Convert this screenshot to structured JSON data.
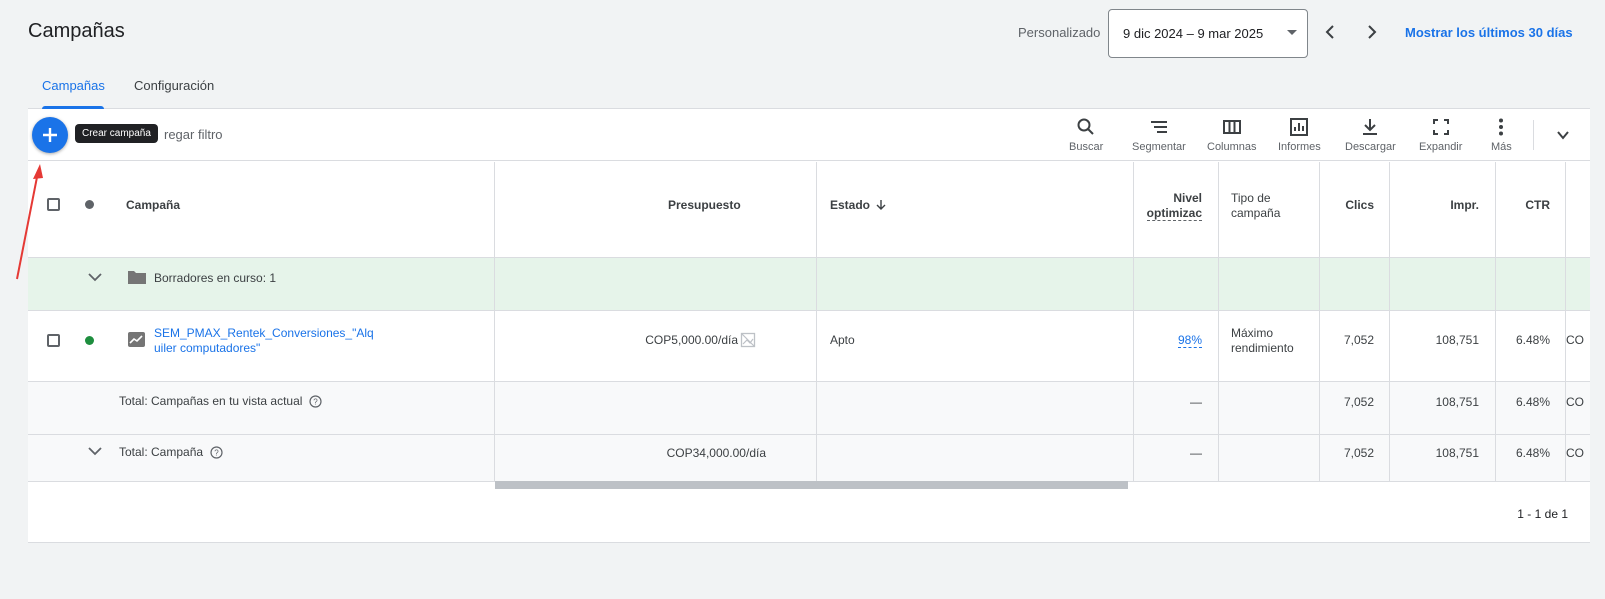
{
  "page": {
    "title": "Campañas"
  },
  "date": {
    "label": "Personalizado",
    "range": "9 dic 2024 – 9 mar 2025",
    "show_last": "Mostrar los últimos 30 días"
  },
  "tabs": [
    {
      "label": "Campañas",
      "active": true
    },
    {
      "label": "Configuración",
      "active": false
    }
  ],
  "toolbar": {
    "create_tooltip": "Crear campaña",
    "filter_label": "regar filtro",
    "tools": [
      {
        "label": "Buscar",
        "icon": "search-icon"
      },
      {
        "label": "Segmentar",
        "icon": "segment-icon"
      },
      {
        "label": "Columnas",
        "icon": "columns-icon"
      },
      {
        "label": "Informes",
        "icon": "reports-icon"
      },
      {
        "label": "Descargar",
        "icon": "download-icon"
      },
      {
        "label": "Expandir",
        "icon": "expand-icon"
      },
      {
        "label": "Más",
        "icon": "more-icon"
      }
    ]
  },
  "table": {
    "headers": {
      "campaign": "Campaña",
      "budget": "Presupuesto",
      "status": "Estado",
      "optimization_line1": "Nivel",
      "optimization_line2": "optimizac",
      "type_line1": "Tipo de",
      "type_line2": "campaña",
      "clicks": "Clics",
      "impressions": "Impr.",
      "ctr": "CTR"
    },
    "draft": {
      "label": "Borradores en curso: 1"
    },
    "rows": [
      {
        "name_line1": "SEM_PMAX_Rentek_Conversiones_\"Alq",
        "name_line2": "uiler computadores\"",
        "budget": "COP5,000.00/día",
        "status": "Apto",
        "optimization": "98%",
        "type_line1": "Máximo",
        "type_line2": "rendimiento",
        "clicks": "7,052",
        "impressions": "108,751",
        "ctr": "6.48%",
        "cut_col": "CO",
        "status_color": "#1e8e3e"
      }
    ],
    "total_view": {
      "label": "Total: Campañas en tu vista actual",
      "optimization": "—",
      "clicks": "7,052",
      "impressions": "108,751",
      "ctr": "6.48%",
      "cut_col": "CO"
    },
    "total_campaign": {
      "label": "Total: Campaña",
      "budget": "COP34,000.00/día",
      "optimization": "—",
      "clicks": "7,052",
      "impressions": "108,751",
      "ctr": "6.48%",
      "cut_col": "CO"
    }
  },
  "pagination": {
    "text": "1 - 1 de 1"
  },
  "colors": {
    "accent": "#1a73e8",
    "draft_bg": "#e6f4ea",
    "annotation_arrow": "#e53935"
  }
}
